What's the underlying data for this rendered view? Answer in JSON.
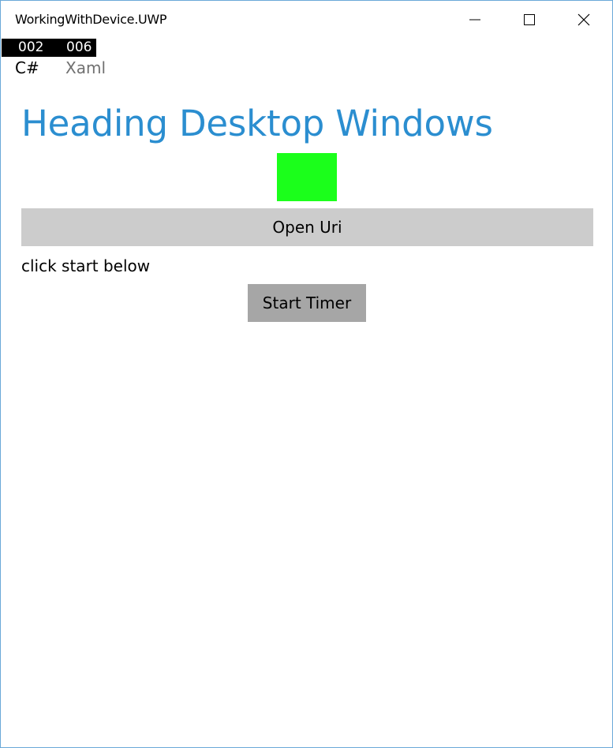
{
  "window": {
    "title": "WorkingWithDevice.UWP",
    "controls": {
      "minimize_icon": "minimize-icon",
      "maximize_icon": "maximize-icon",
      "close_icon": "close-icon"
    }
  },
  "counters": {
    "first": "002",
    "second": "006"
  },
  "languages": {
    "csharp": "C#",
    "xaml": "Xaml"
  },
  "main": {
    "heading": "Heading Desktop Windows",
    "open_uri_label": "Open Uri",
    "hint": "click start below",
    "start_timer_label": "Start Timer"
  },
  "colors": {
    "heading": "#2b8ed0",
    "indicator": "#1bff1b",
    "open_uri_bg": "#cccccc",
    "start_timer_bg": "#a6a6a6",
    "counter_bg": "#000000",
    "window_border": "#6aa9d8"
  }
}
